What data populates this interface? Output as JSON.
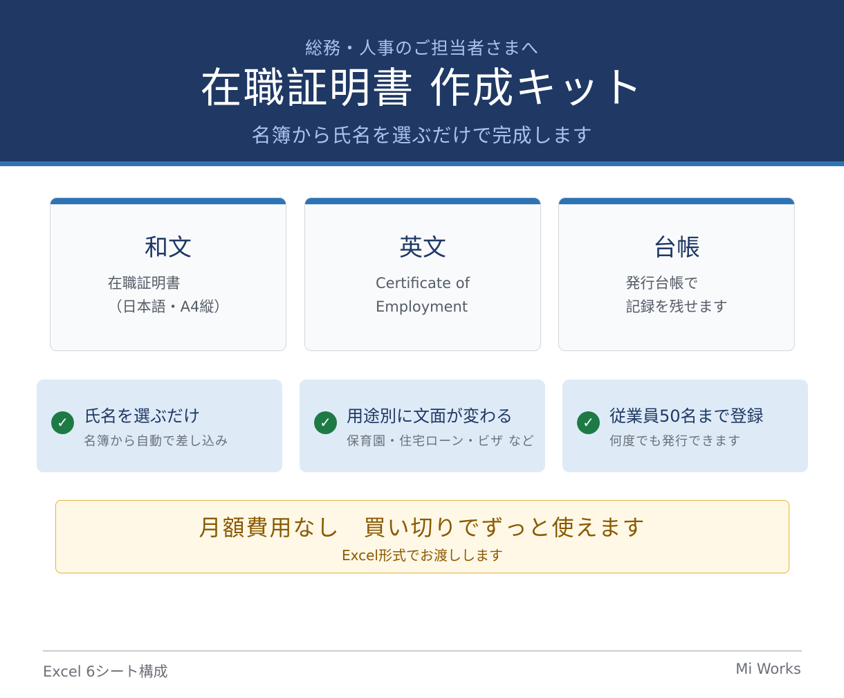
{
  "header": {
    "eyebrow": "総務・人事のご担当者さまへ",
    "title": "在職証明書 作成キット",
    "subtitle": "名簿から氏名を選ぶだけで完成します"
  },
  "cards": [
    {
      "title": "和文",
      "lines": [
        "在職証明書",
        "（日本語・A4縦）"
      ]
    },
    {
      "title": "英文",
      "lines": [
        "Certificate of",
        "Employment"
      ]
    },
    {
      "title": "台帳",
      "lines": [
        "発行台帳で",
        "記録を残せます"
      ]
    }
  ],
  "features": [
    {
      "icon": "check-icon",
      "title": "氏名を選ぶだけ",
      "sub": "名簿から自動で差し込み"
    },
    {
      "icon": "check-icon",
      "title": "用途別に文面が変わる",
      "sub": "保育園・住宅ローン・ビザ など"
    },
    {
      "icon": "check-icon",
      "title": "従業員50名まで登録",
      "sub": "何度でも発行できます"
    }
  ],
  "promo": {
    "title": "月額費用なし　買い切りでずっと使えます",
    "sub": "Excel形式でお渡しします"
  },
  "footer": {
    "left": "Excel 6シート構成",
    "right": "Mi Works"
  },
  "colors": {
    "header_bg": "#1f3864",
    "accent": "#2e74b5",
    "feature_bg": "#deebf7",
    "check": "#1e7a45",
    "promo_bg": "#fff8e7",
    "promo_text": "#8a5a00"
  }
}
